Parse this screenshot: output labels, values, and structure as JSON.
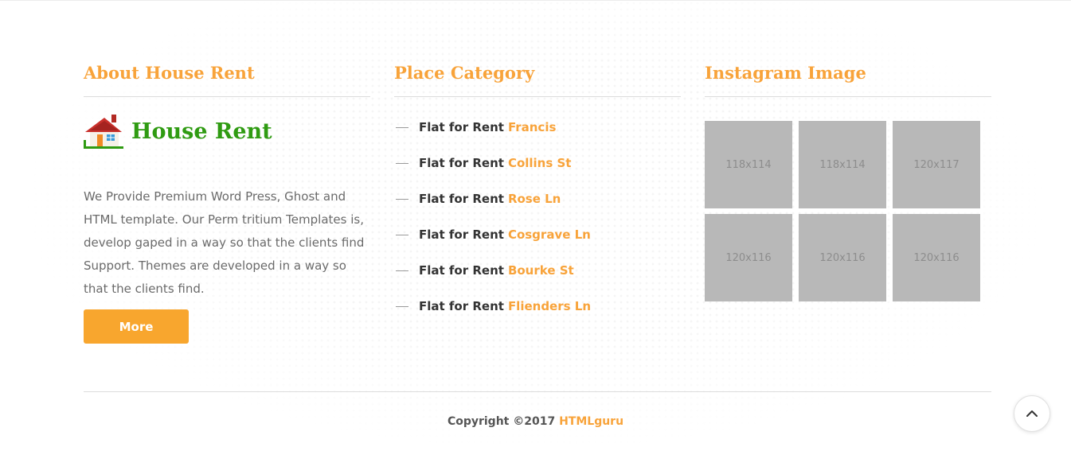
{
  "about": {
    "title": "About House Rent",
    "brand": "House Rent",
    "logo_icon": "house-icon",
    "text": "We Provide Premium Word Press, Ghost and HTML template. Our Perm tritium Templates is, develop gaped in a way so that the clients find Support. Themes are developed in a way so that the clients find.",
    "more_label": "More"
  },
  "categories": {
    "title": "Place Category",
    "items": [
      {
        "label": "Flat for Rent",
        "place": "Francis"
      },
      {
        "label": "Flat for Rent",
        "place": "Collins St"
      },
      {
        "label": "Flat for Rent",
        "place": "Rose Ln"
      },
      {
        "label": "Flat for Rent",
        "place": "Cosgrave Ln"
      },
      {
        "label": "Flat for Rent",
        "place": "Bourke St"
      },
      {
        "label": "Flat for Rent",
        "place": "Fliendеrs Ln"
      }
    ]
  },
  "instagram": {
    "title": "Instagram Image",
    "images": [
      "118x114",
      "118x114",
      "120x117",
      "120x116",
      "120x116",
      "120x116"
    ]
  },
  "footer": {
    "copyright": "Copyright ©2017",
    "brand": "HTMLguru",
    "scroll_icon": "chevron-up-icon"
  },
  "colors": {
    "accent": "#f8a33a",
    "brand_green": "#2f9b12",
    "button": "#f8a62e",
    "placeholder": "#b8b8b8"
  }
}
